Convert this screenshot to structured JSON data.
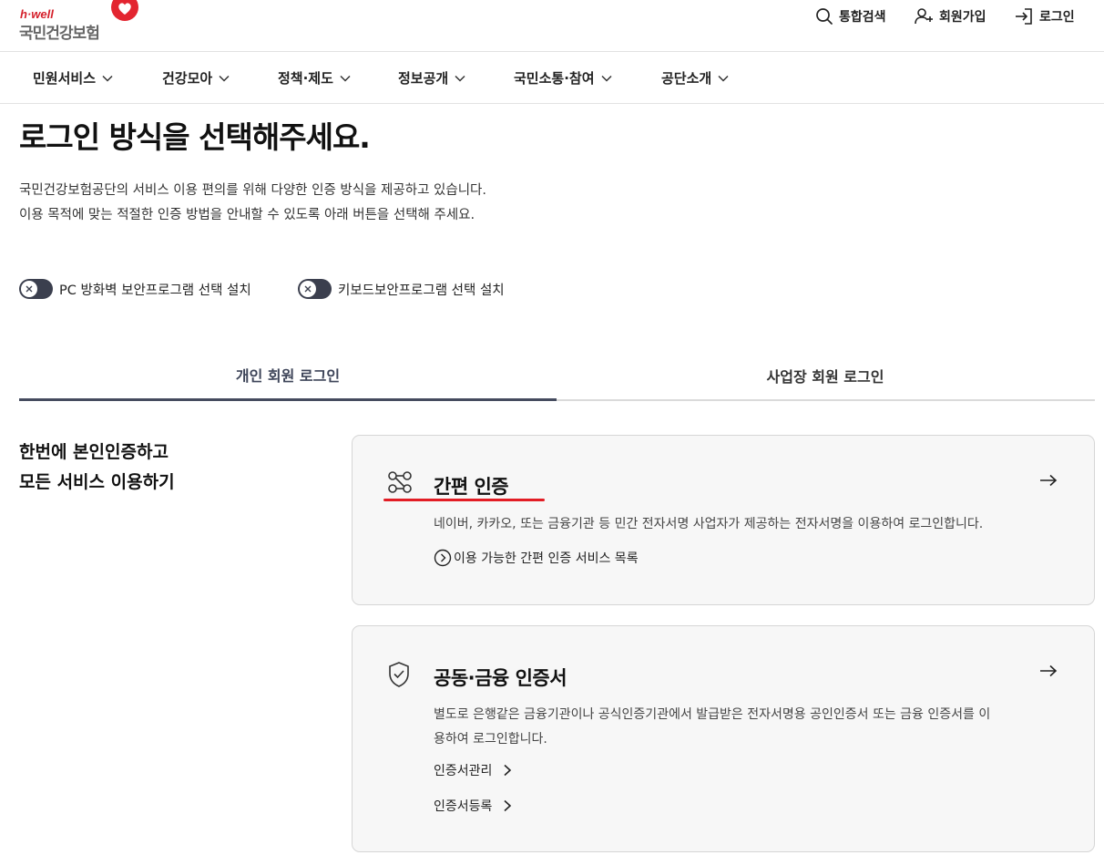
{
  "header": {
    "logo_small": "h·well",
    "logo_main": "국민건강보험",
    "search_label": "통합검색",
    "signup_label": "회원가입",
    "login_label": "로그인"
  },
  "gnb": {
    "items": [
      {
        "label": "민원서비스"
      },
      {
        "label": "건강모아"
      },
      {
        "label": "정책·제도"
      },
      {
        "label": "정보공개"
      },
      {
        "label": "국민소통·참여"
      },
      {
        "label": "공단소개"
      }
    ]
  },
  "main": {
    "title": "로그인 방식을 선택해주세요.",
    "intro_line1": "국민건강보험공단의 서비스 이용 편의를 위해 다양한 인증 방식을 제공하고 있습니다.",
    "intro_line2": "이용 목적에 맞는 적절한 인증 방법을 안내할 수 있도록 아래 버튼을 선택해 주세요."
  },
  "toggles": {
    "firewall_label": "PC 방화벽 보안프로그램 선택 설치",
    "keyboard_label": "키보드보안프로그램 선택 설치"
  },
  "tabs": {
    "personal": "개인 회원 로그인",
    "business": "사업장 회원 로그인",
    "active": "personal"
  },
  "side": {
    "line1": "한번에 본인인증하고",
    "line2": "모든 서비스 이용하기"
  },
  "cards": {
    "simple": {
      "title": "간편 인증",
      "desc": "네이버, 카카오, 또는 금융기관 등 민간 전자서명 사업자가 제공하는 전자서명을 이용하여 로그인합니다.",
      "link": "이용 가능한 간편 인증 서비스 목록"
    },
    "cert": {
      "title": "공동·금융 인증서",
      "desc_line1": "별도로 은행같은 금융기관이나 공식인증기관에서 발급받은 전자서명용 공인인증서 또는 금융 인증서를 이",
      "desc_line2": "용하여 로그인합니다.",
      "link1": "인증서관리",
      "link2": "인증서등록"
    }
  },
  "colors": {
    "accent_red": "#e21d25",
    "dark_navy": "#3b3f4e",
    "card_bg": "#f7f7f7"
  }
}
